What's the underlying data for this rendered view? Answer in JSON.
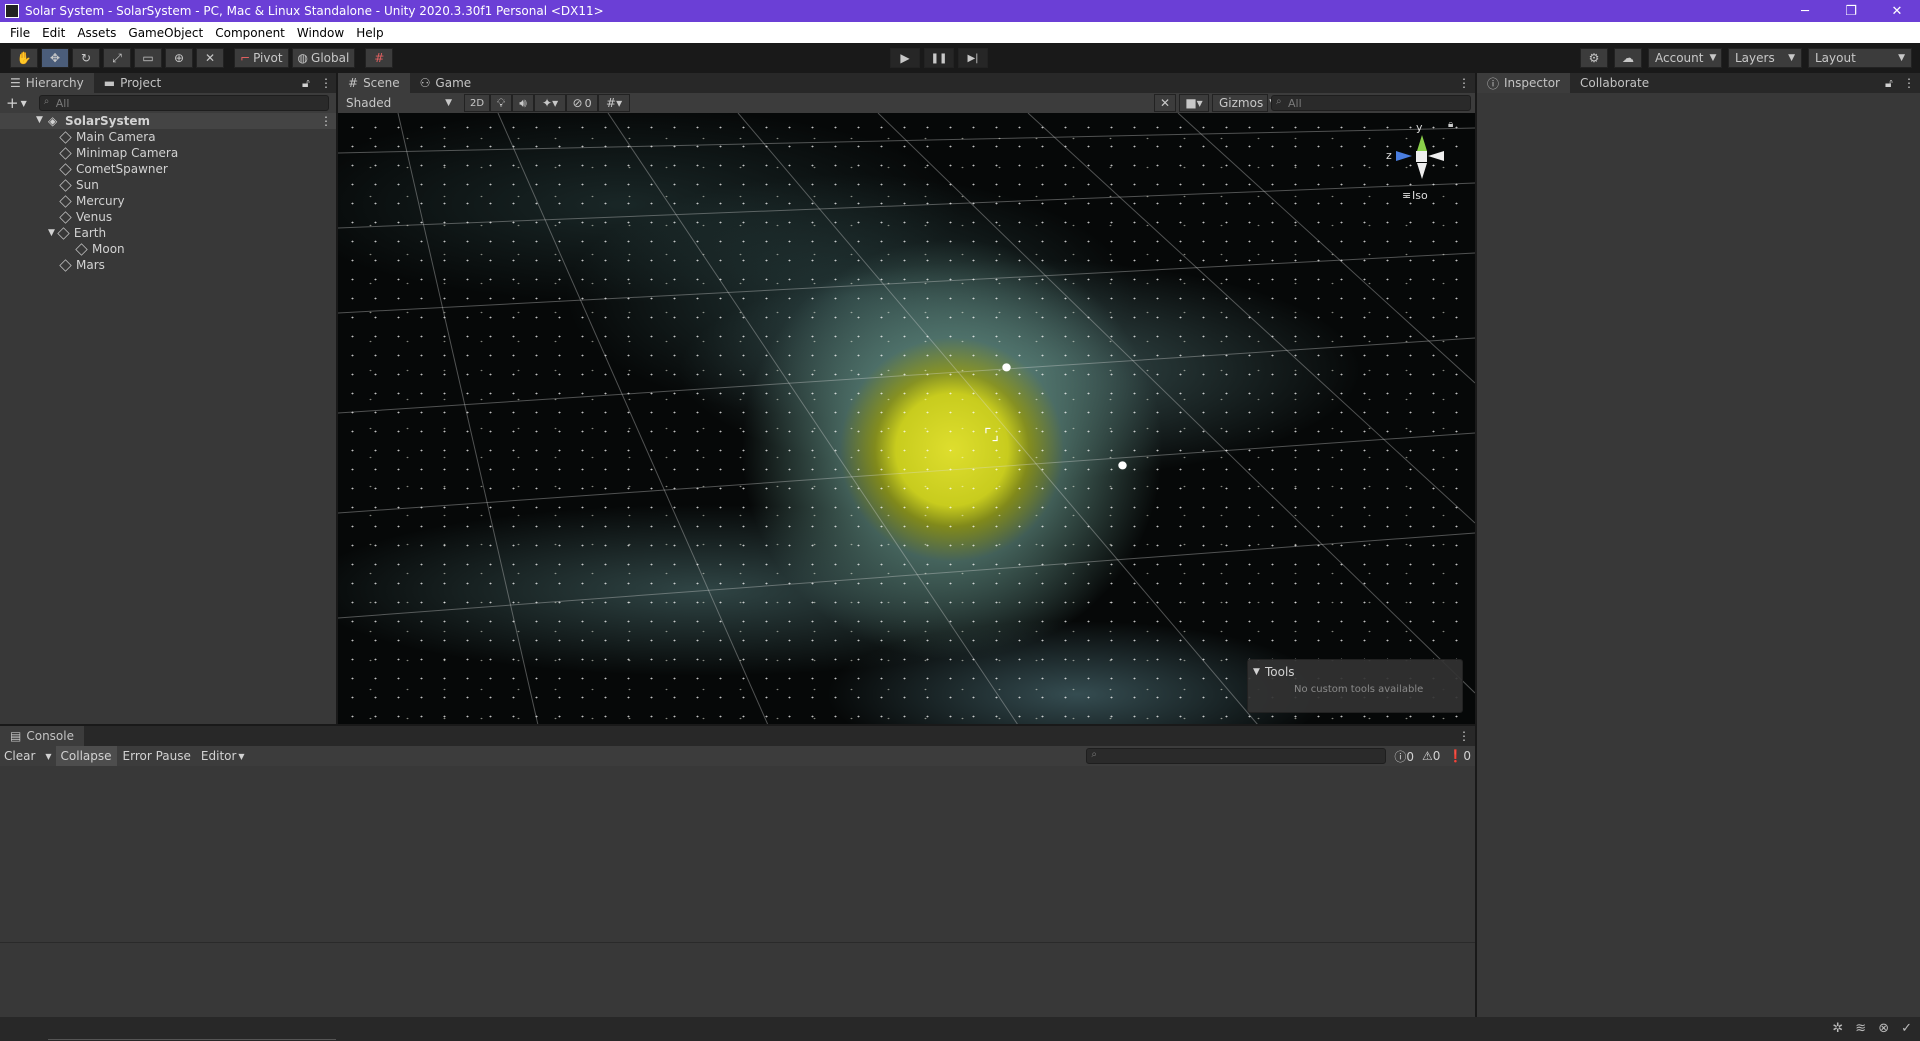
{
  "window": {
    "title": "Solar System - SolarSystem - PC, Mac & Linux Standalone - Unity 2020.3.30f1 Personal <DX11>",
    "controls": [
      "─",
      "❐",
      "✕"
    ]
  },
  "menu": [
    "File",
    "Edit",
    "Assets",
    "GameObject",
    "Component",
    "Window",
    "Help"
  ],
  "toolbar": {
    "tools": [
      "hand-icon",
      "move-icon",
      "rotate-icon",
      "scale-icon",
      "rect-icon",
      "transform-icon",
      "custom-tool-icon"
    ],
    "pivot_label": "Pivot",
    "global_label": "Global",
    "play": [
      "▶",
      "❚❚",
      "▶|"
    ],
    "account_label": "Account",
    "layers_label": "Layers",
    "layout_label": "Layout"
  },
  "hierarchy": {
    "tabs": [
      "Hierarchy",
      "Project"
    ],
    "add_label": "+",
    "search_placeholder": "All",
    "scene_name": "SolarSystem",
    "items": [
      {
        "label": "Main Camera",
        "depth": 1
      },
      {
        "label": "Minimap Camera",
        "depth": 1
      },
      {
        "label": "CometSpawner",
        "depth": 1
      },
      {
        "label": "Sun",
        "depth": 1
      },
      {
        "label": "Mercury",
        "depth": 1
      },
      {
        "label": "Venus",
        "depth": 1
      },
      {
        "label": "Earth",
        "depth": 1,
        "expanded": true
      },
      {
        "label": "Moon",
        "depth": 2
      },
      {
        "label": "Mars",
        "depth": 1
      }
    ]
  },
  "scene_view": {
    "tabs": [
      "Scene",
      "Game"
    ],
    "shading": "Shaded",
    "two_d": "2D",
    "hidden_count": "0",
    "gizmos_label": "Gizmos",
    "search_placeholder": "All",
    "gizmo_axes": {
      "y": "y",
      "z": "z"
    },
    "projection": "Iso",
    "tools_overlay": {
      "title": "Tools",
      "message": "No custom tools available"
    }
  },
  "console": {
    "tab": "Console",
    "clear_label": "Clear",
    "collapse_label": "Collapse",
    "error_pause_label": "Error Pause",
    "editor_label": "Editor",
    "counts": {
      "info": "0",
      "warnings": "0",
      "errors": "0"
    }
  },
  "inspector": {
    "tabs": [
      "Inspector",
      "Collaborate"
    ]
  }
}
